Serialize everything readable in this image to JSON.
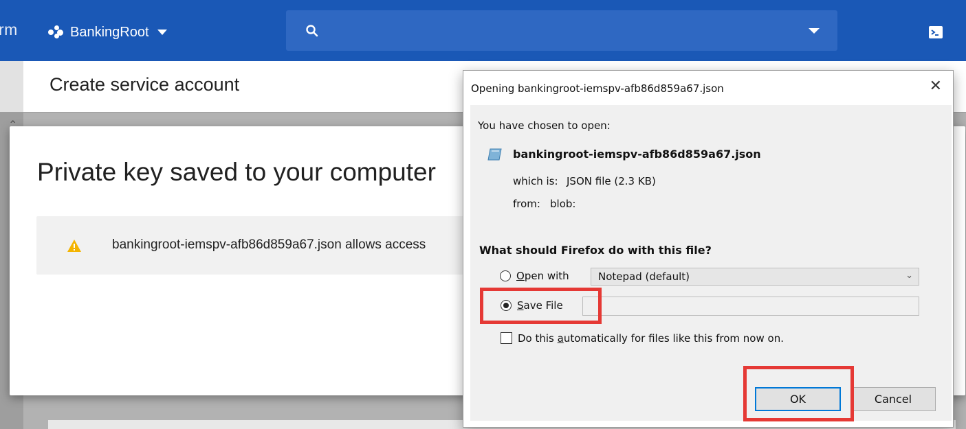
{
  "topbar": {
    "app_fragment": "rm",
    "project_name": "BankingRoot"
  },
  "page": {
    "title": "Create service account"
  },
  "key_dialog": {
    "title": "Private key saved to your computer",
    "notice": "bankingroot-iemspv-afb86d859a67.json allows access"
  },
  "firefox_dialog": {
    "title": "Opening bankingroot-iemspv-afb86d859a67.json",
    "chosen_label": "You have chosen to open:",
    "file_name": "bankingroot-iemspv-afb86d859a67.json",
    "which_is_label": "which is:",
    "which_is_value": "JSON file (2.3 KB)",
    "from_label": "from:",
    "from_value": "blob:",
    "question": "What should Firefox do with this file?",
    "open_with_label_pre": "O",
    "open_with_label_post": "pen with",
    "open_with_app": "Notepad (default)",
    "save_file_label_pre": "S",
    "save_file_label_post": "ave File",
    "auto_label_pre": "Do this ",
    "auto_label_acc": "a",
    "auto_label_post": "utomatically for files like this from now on.",
    "selected_option": "save_file",
    "ok_label": "OK",
    "cancel_label": "Cancel"
  },
  "colors": {
    "topbar": "#1a58b6",
    "search": "#2f68c2",
    "highlight": "#e53935",
    "focus": "#0078d7",
    "warning": "#f4b400"
  },
  "icons": [
    "search-icon",
    "project-dots-icon",
    "chevron-down-icon",
    "cloud-shell-icon",
    "warning-icon",
    "file-icon",
    "close-icon",
    "collapse-arrow-icon"
  ]
}
